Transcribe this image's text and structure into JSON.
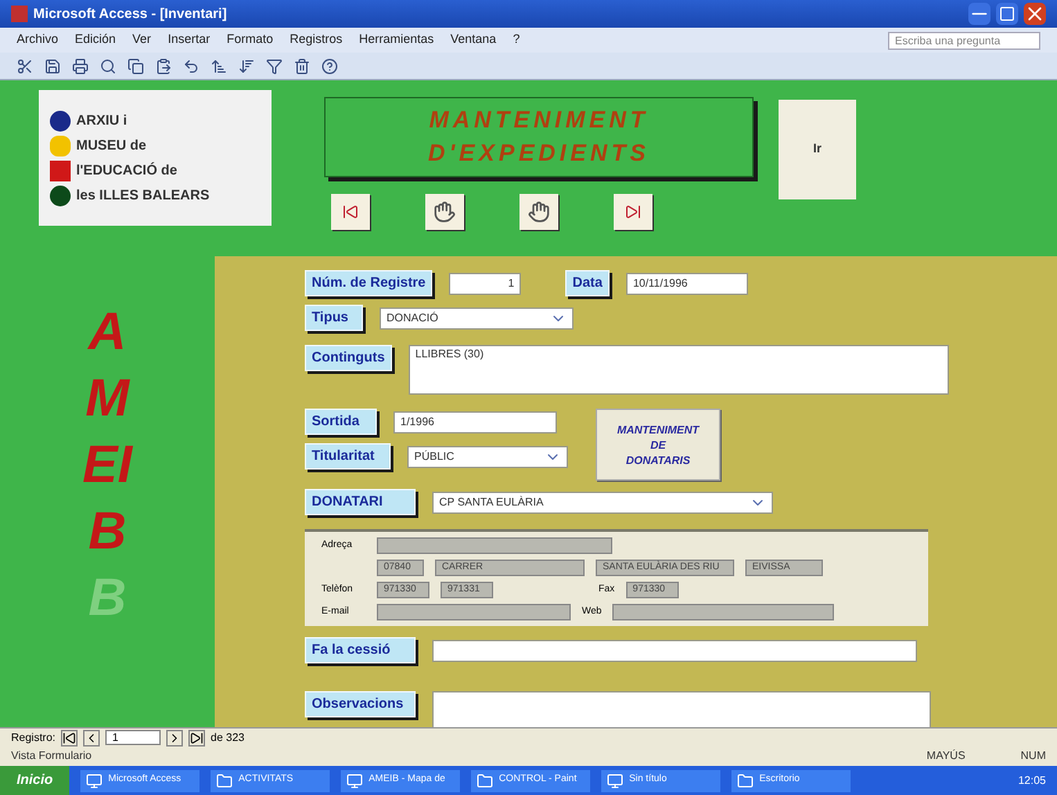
{
  "window": {
    "title": "Microsoft Access - [Inventari]"
  },
  "menu": [
    "Archivo",
    "Edición",
    "Ver",
    "Insertar",
    "Formato",
    "Registros",
    "Herramientas",
    "Ventana",
    "?"
  ],
  "help_box": {
    "placeholder": "Escriba una pregunta"
  },
  "logo": {
    "lines": [
      {
        "text": "ARXIU i",
        "color": "#1a2a8a"
      },
      {
        "text": "MUSEU de",
        "color": "#f2c200"
      },
      {
        "text": "l'EDUCACIÓ de",
        "color": "#d01818"
      },
      {
        "text": "les ILLES BALEARS",
        "color": "#0d4a1a"
      }
    ]
  },
  "header": {
    "title_lines": [
      "MANTENIMENT",
      "D'EXPEDIENTS"
    ],
    "go_button": "Ir"
  },
  "nav_buttons": [
    {
      "kind": "first"
    },
    {
      "kind": "prev"
    },
    {
      "kind": "next"
    },
    {
      "kind": "last"
    }
  ],
  "side_letters": [
    {
      "text": "A",
      "dim": false
    },
    {
      "text": "M",
      "dim": false
    },
    {
      "text": "EI",
      "dim": false
    },
    {
      "text": "B",
      "dim": false
    },
    {
      "text": "B",
      "dim": true
    }
  ],
  "form": {
    "registre": {
      "label": "Núm. de Registre",
      "value": "1"
    },
    "data": {
      "label": "Data",
      "value": "10/11/1996"
    },
    "tipus": {
      "label": "Tipus",
      "value": "DONACIÓ"
    },
    "continguts": {
      "label": "Continguts",
      "value": "LLIBRES (30)"
    },
    "sortida": {
      "label": "Sortida",
      "value": "1/1996"
    },
    "titularitat": {
      "label": "Titularitat",
      "value": "PÚBLIC"
    },
    "donataris_button": [
      "MANTENIMENT",
      "DE",
      "DONATARIS"
    ],
    "donatari": {
      "label": "DONATARI",
      "value": "CP SANTA EULÀRIA"
    },
    "address": {
      "adreca_label": "Adreça",
      "postal": [
        "07840",
        "CARRER",
        "SANTA EULÀRIA DES RIU",
        "EIVISSA"
      ],
      "telefon_label": "Telèfon",
      "telefons": [
        "971330",
        "971331"
      ],
      "fax_label": "Fax",
      "fax": "971330",
      "email_label": "E-mail",
      "web_label": "Web"
    },
    "cessio": {
      "label": "Fa la cessió"
    },
    "observacions": {
      "label": "Observacions"
    }
  },
  "record_nav": {
    "label": "Registro:",
    "current": "1",
    "total": "de 323"
  },
  "status_bar": {
    "left": "Vista Formulario",
    "right": [
      "MAYÚS",
      "NUM"
    ]
  },
  "taskbar": {
    "start": "Inicio",
    "items": [
      "Microsoft Access",
      "ACTIVITATS",
      "AMEIB - Mapa de",
      "CONTROL - Paint",
      "Sin título",
      "Escritorio"
    ],
    "clock": "12:05"
  }
}
